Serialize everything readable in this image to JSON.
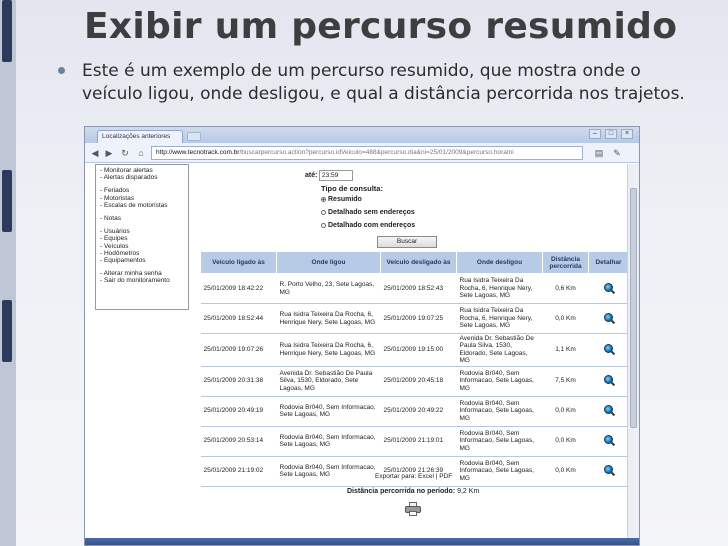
{
  "slide": {
    "title": "Exibir um percurso resumido",
    "bullet": "Este é um exemplo de um percurso resumido, que mostra onde o veículo ligou, onde desligou, e qual a distância percorrida nos trajetos."
  },
  "browser": {
    "tab_title": "Localizações anteriores",
    "url_host": "http://www.tecnotrack.com.br",
    "url_path": "/buscarpercurso.action?percurso.idVeiculo=488&percurso.dia&ni=25/01/2009&percurso.horaIni",
    "window_controls": [
      "–",
      "□",
      "×"
    ],
    "nav_icons": [
      "back-icon",
      "forward-icon",
      "reload-icon",
      "home-icon"
    ],
    "toolbar_icons": [
      "page-icon",
      "wrench-icon"
    ]
  },
  "side_menu": {
    "groups": [
      [
        "- Monitorar alertas",
        "- Alertas disparados"
      ],
      [
        "- Feriados",
        "- Motoristas",
        "- Escalas de motoristas"
      ],
      [
        "- Notas"
      ],
      [
        "- Usuários",
        "- Equipes",
        "- Veículos",
        "- Hodômetros",
        "- Equipamentos"
      ],
      [
        "- Alterar minha senha",
        "- Sair do monitoramento"
      ]
    ]
  },
  "form": {
    "ate_label": "até:",
    "ate_value": "23:59",
    "tipo_label": "Tipo de consulta:",
    "options": [
      "Resumido",
      "Detalhado sem endereços",
      "Detalhado com endereços"
    ],
    "selected_option": "Resumido",
    "search_button": "Buscar"
  },
  "table": {
    "headers": [
      "Veículo ligado às",
      "Onde ligou",
      "Veículo desligado às",
      "Onde desligou",
      "Distância percorrida",
      "Detalhar"
    ],
    "rows": [
      [
        "25/01/2009 18:42:22",
        "R. Porto Velho, 23, Sete Lagoas, MG",
        "25/01/2009 18:52:43",
        "Rua Isidra Teixeira Da Rocha, 6, Henrique Nery, Sete Lagoas, MG",
        "0,6 Km"
      ],
      [
        "25/01/2009 18:52:44",
        "Rua Isidra Teixeira Da Rocha, 6, Henrique Nery, Sete Lagoas, MG",
        "25/01/2009 19:07:25",
        "Rua Isidra Teixeira Da Rocha, 6, Henrique Nery, Sete Lagoas, MG",
        "0,0 Km"
      ],
      [
        "25/01/2009 19:07:26",
        "Rua Isidra Teixeira Da Rocha, 6, Henrique Nery, Sete Lagoas, MG",
        "25/01/2009 19:15:00",
        "Avenida Dr. Sebastião De Paula Silva, 1530, Eldorado, Sete Lagoas, MG",
        "1,1 Km"
      ],
      [
        "25/01/2009 20:31:38",
        "Avenida Dr. Sebastião De Paula Silva, 1530, Eldorado, Sete Lagoas, MG",
        "25/01/2009 20:45:18",
        "Rodovia Br040, Sem Informacao, Sete Lagoas, MG",
        "7,5 Km"
      ],
      [
        "25/01/2009 20:49:19",
        "Rodovia Br040, Sem Informacao, Sete Lagoas, MG",
        "25/01/2009 20:49:22",
        "Rodovia Br040, Sem Informacao, Sete Lagoas, MG",
        "0,0 Km"
      ],
      [
        "25/01/2009 20:53:14",
        "Rodovia Br040, Sem Informacao, Sete Lagoas, MG",
        "25/01/2009 21:19:01",
        "Rodovia Br040, Sem Informacao, Sete Lagoas, MG",
        "0,0 Km"
      ],
      [
        "25/01/2009 21:19:02",
        "Rodovia Br040, Sem Informacao, Sete Lagoas, MG",
        "25/01/2009 21:26:39",
        "Rodovia Br040, Sem Informacao, Sete Lagoas, MG",
        "0,0 Km"
      ]
    ]
  },
  "footer": {
    "export_label": "Exportar para: Excel | PDF",
    "distance_label": "Distância percorrida no período:",
    "distance_value": "9,2 Km"
  },
  "colors": {
    "header_bg": "#b8cbe6",
    "header_text": "#1f3b66",
    "slide_bullet": "#6f7f9f"
  }
}
